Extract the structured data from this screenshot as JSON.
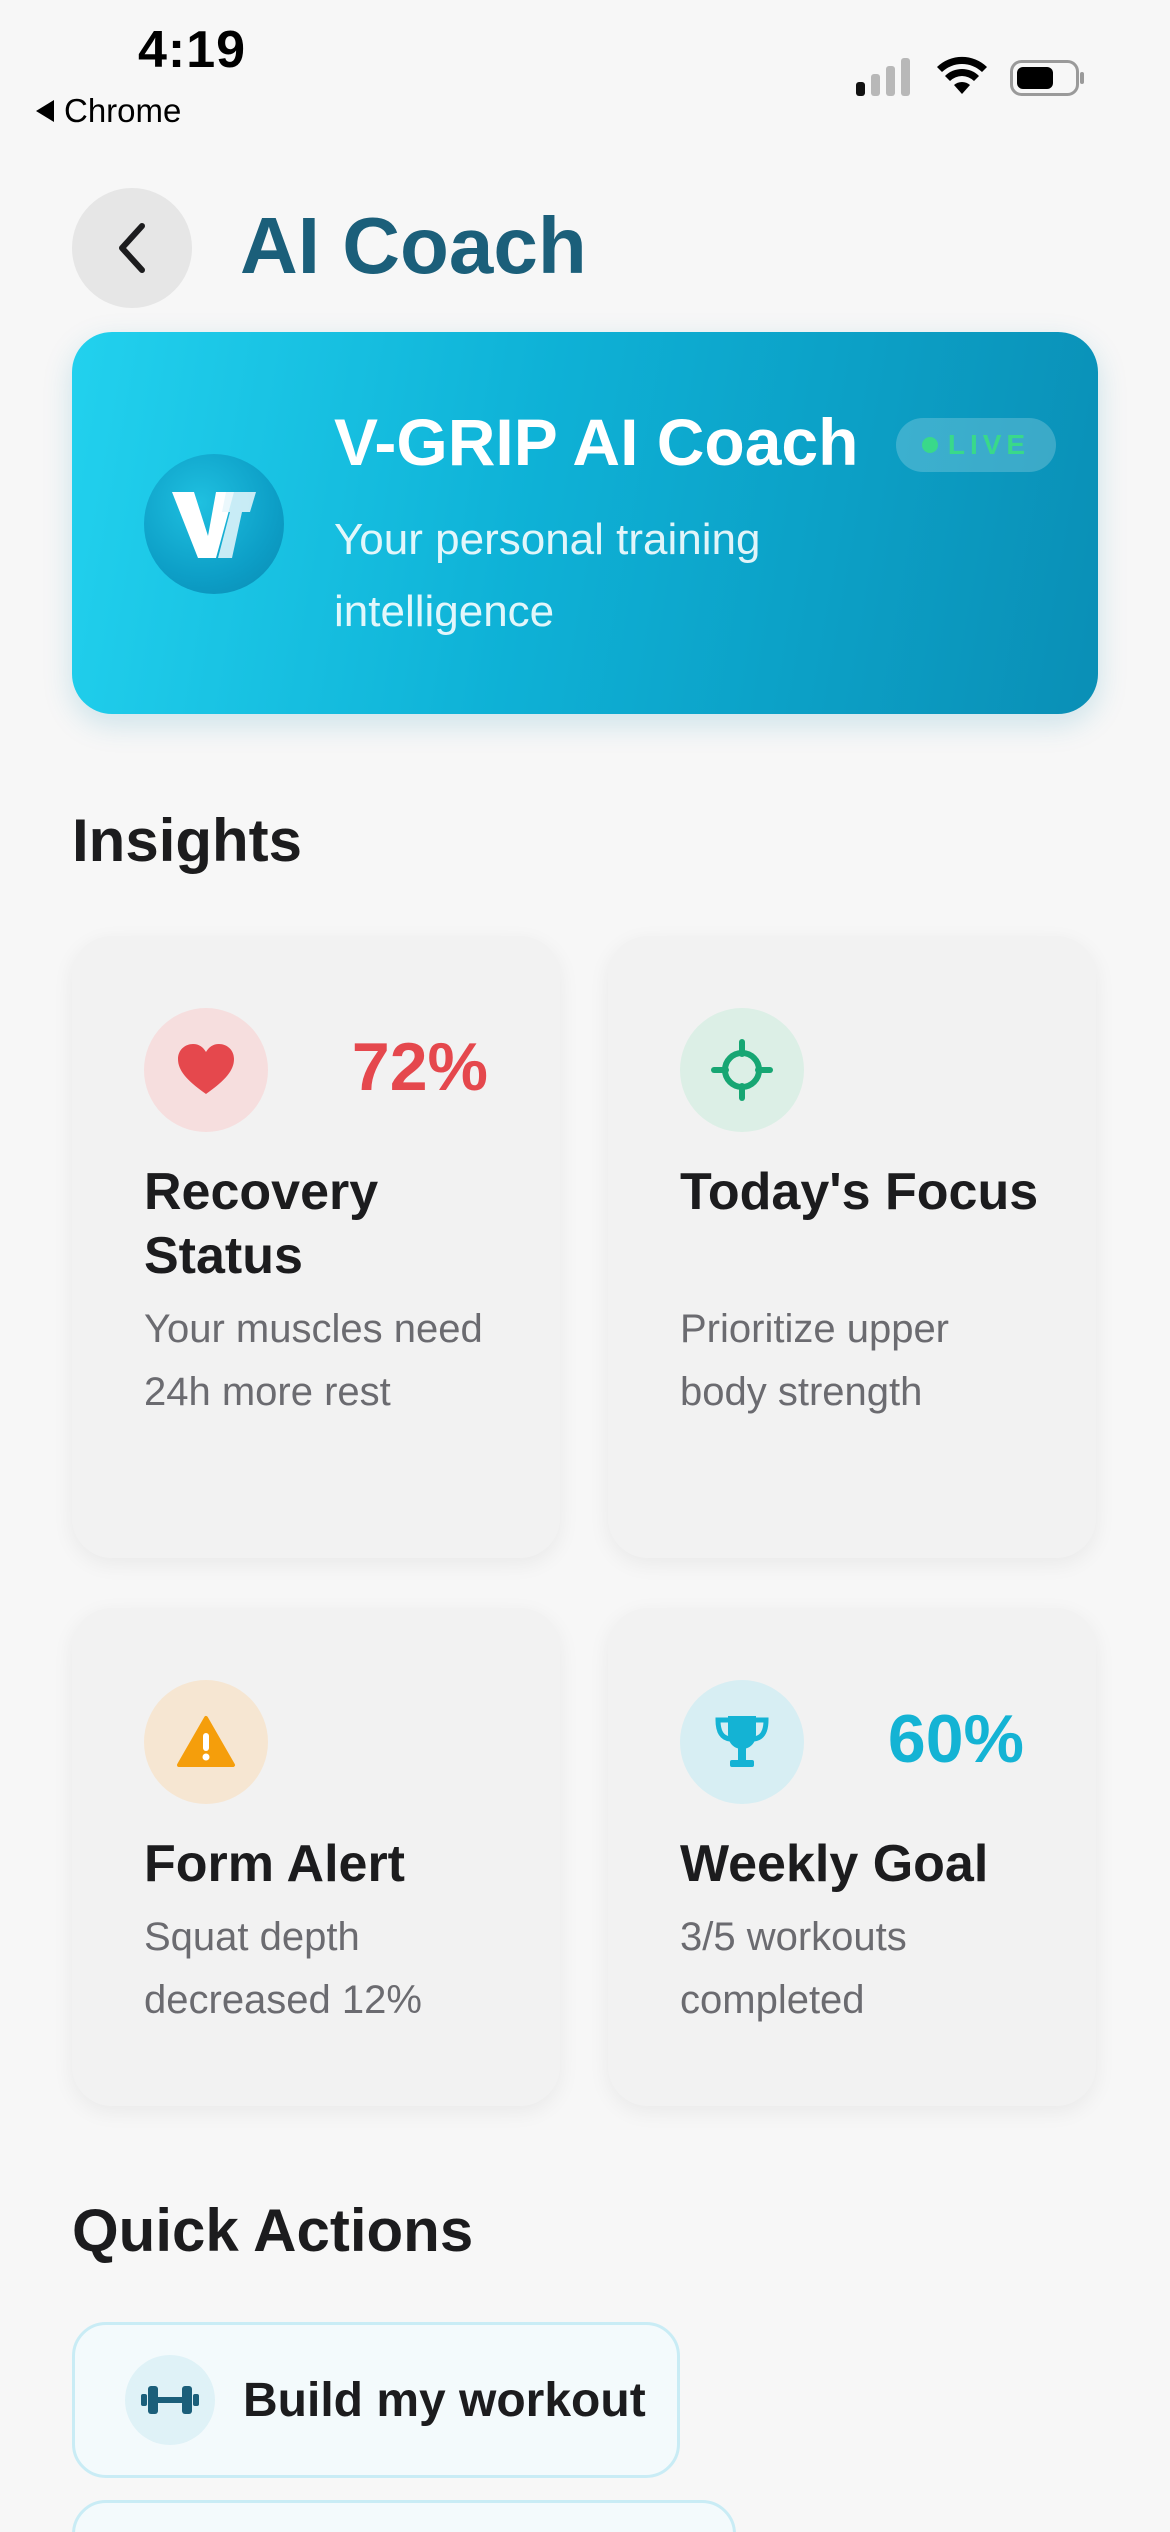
{
  "status_bar": {
    "time": "4:19",
    "back_app": "Chrome"
  },
  "header": {
    "title": "AI Coach"
  },
  "hero": {
    "title": "V-GRIP AI Coach",
    "badge": "LIVE",
    "subtitle": "Your personal training intelligence",
    "logo_text": "V"
  },
  "insights": {
    "heading": "Insights",
    "cards": [
      {
        "icon": "heart-icon",
        "value": "72%",
        "title": "Recovery Status",
        "description": "Your muscles need 24h more rest",
        "accent": "#e5484d"
      },
      {
        "icon": "target-icon",
        "value": "",
        "title": "Today's Focus",
        "description": "Prioritize upper body strength",
        "accent": "#17a673"
      },
      {
        "icon": "warning-icon",
        "value": "",
        "title": "Form Alert",
        "description": "Squat depth decreased 12%",
        "accent": "#f59e0b"
      },
      {
        "icon": "trophy-icon",
        "value": "60%",
        "title": "Weekly Goal",
        "description": "3/5 workouts completed",
        "accent": "#14b3d4"
      }
    ]
  },
  "quick_actions": {
    "heading": "Quick Actions",
    "items": [
      {
        "icon": "dumbbell-icon",
        "label": "Build my workout"
      }
    ]
  }
}
